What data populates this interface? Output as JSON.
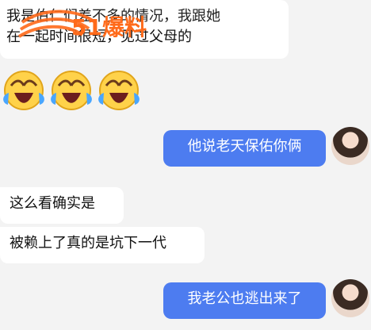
{
  "messages": [
    {
      "side": "left",
      "text_line1": "我是",
      "text_line2": "在一起时间很短，见过父母的"
    },
    {
      "side": "right",
      "text": "他说老天保佑你俩"
    },
    {
      "side": "left",
      "text": "这么看确实是"
    },
    {
      "side": "left",
      "text": "被赖上了真的是坑下一代"
    },
    {
      "side": "right",
      "text": "我老公也逃出来了"
    }
  ],
  "watermark": {
    "text": "51爆料",
    "accent": "#ff6a1a"
  },
  "emoji": {
    "name": "crying-laughing-icon",
    "count": 3,
    "face": "#ffd24a",
    "tear": "#49a6ff"
  },
  "colors": {
    "bubble_right": "#4d7cf0",
    "bubble_left": "#ffffff",
    "background": "#f3f3f3"
  }
}
